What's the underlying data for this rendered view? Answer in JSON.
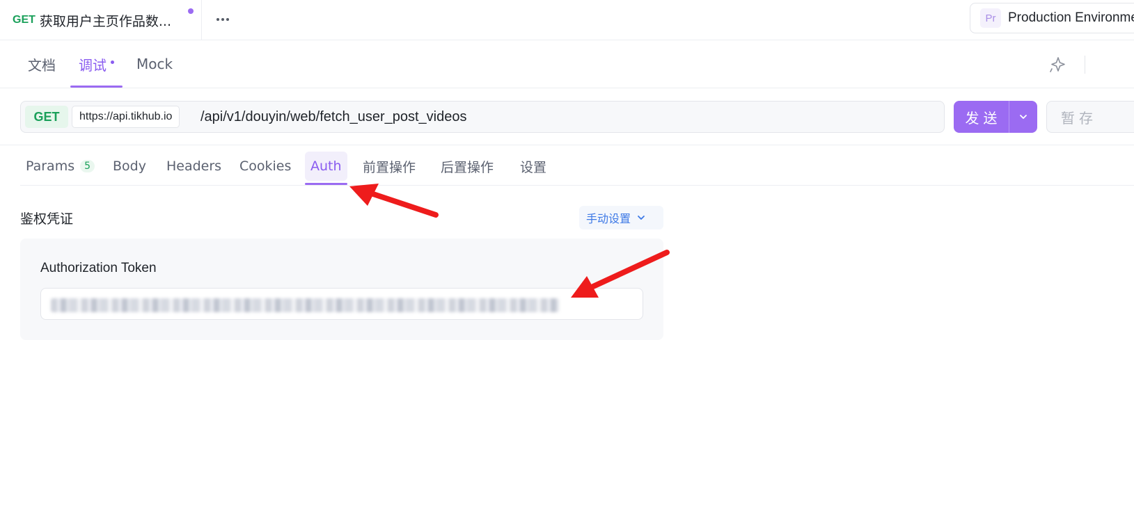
{
  "top_tab": {
    "method": "GET",
    "title": "获取用户主页作品数..."
  },
  "environment": {
    "badge": "Pr",
    "name": "Production Environment"
  },
  "mode_tabs": [
    {
      "label": "文档"
    },
    {
      "label": "调试"
    },
    {
      "label": "Mock"
    }
  ],
  "request": {
    "method": "GET",
    "base_url": "https://api.tikhub.io",
    "path": "/api/v1/douyin/web/fetch_user_post_videos",
    "send_label": "发送",
    "save_label": "暂存"
  },
  "request_tabs": [
    {
      "label": "Params",
      "count": "5"
    },
    {
      "label": "Body"
    },
    {
      "label": "Headers"
    },
    {
      "label": "Cookies"
    },
    {
      "label": "Auth"
    },
    {
      "label": "前置操作"
    },
    {
      "label": "后置操作"
    },
    {
      "label": "设置"
    }
  ],
  "auth": {
    "section_label": "鉴权凭证",
    "mode_label": "手动设置",
    "token_label": "Authorization Token"
  },
  "colors": {
    "accent": "#9b6bf2",
    "method_get": "#1aa05a",
    "annotation": "#ee1c1c"
  }
}
